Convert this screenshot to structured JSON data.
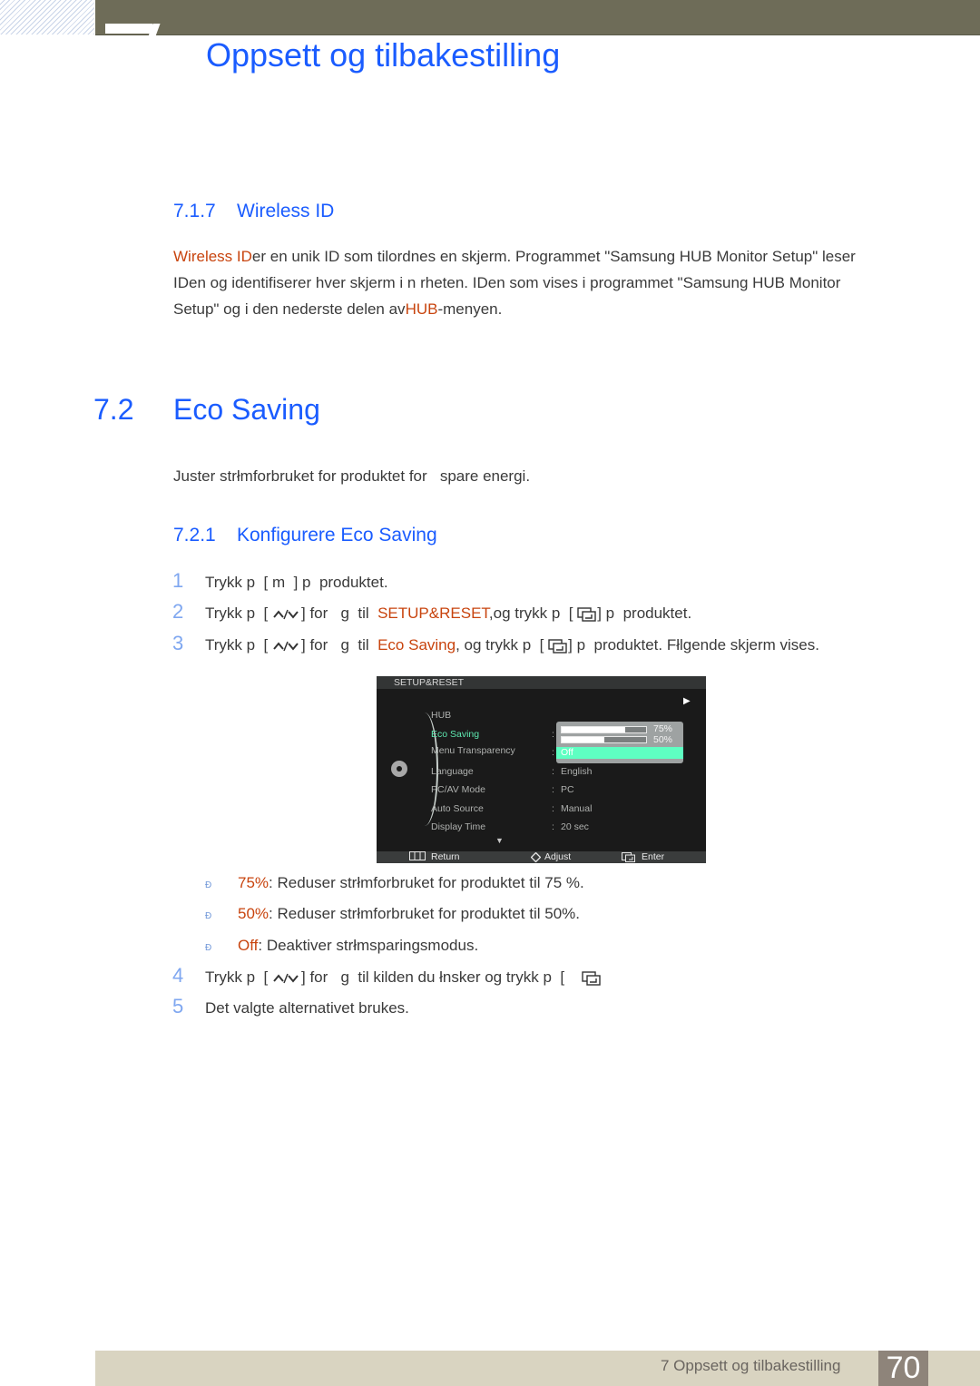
{
  "header": {
    "chapter_title": "Oppsett og tilbakestilling"
  },
  "section_717": {
    "number": "7.1.7",
    "title": "Wireless ID",
    "para": {
      "hl1": "Wireless ID",
      "text1": "er en unik ID som tilordnes en skjerm. Programmet \"Samsung HUB Monitor Setup\" leser",
      "line2": "IDen og identifiserer hver skjerm i n rheten. IDen som vises i programmet \"Samsung HUB Monitor",
      "line3a": "Setup\" og i den nederste delen av",
      "hl2": "HUB",
      "line3b": "-menyen."
    }
  },
  "section_72": {
    "number": "7.2",
    "title": "Eco Saving",
    "intro": "Juster strłmforbruket for produktet for   spare energi."
  },
  "section_721": {
    "number": "7.2.1",
    "title": "Konfigurere Eco Saving",
    "steps": [
      {
        "n": "1",
        "a": "Trykk p  [ m  ] p  produktet."
      },
      {
        "n": "2",
        "a": "Trykk p  [",
        "b": "] for   g  til  ",
        "hl": "SETUP&RESET",
        "c": ",og trykk p  [",
        "d": "] p  produktet."
      },
      {
        "n": "3",
        "a": "Trykk p  [",
        "b": "] for   g  til  ",
        "hl": "Eco Saving",
        "c": ", og trykk p  [",
        "d": "] p  produktet. Fłlgende skjerm vises."
      },
      {
        "n": "4",
        "a": "Trykk p  [",
        "b": "] for   g  til kilden du łnsker og trykk p  ["
      },
      {
        "n": "5",
        "a": "Det valgte alternativet brukes."
      }
    ],
    "bullets": [
      {
        "marker": "Ð",
        "hl": "75%",
        "text": ": Reduser strłmforbruket for produktet til 75 %."
      },
      {
        "marker": "Ð",
        "hl": "50%",
        "text": ": Reduser strłmforbruket for produktet til 50%."
      },
      {
        "marker": "Ð",
        "hl": "Off",
        "text": ": Deaktiver strłmsparingsmodus."
      }
    ]
  },
  "osd": {
    "title": "SETUP&RESET",
    "items": [
      {
        "label": "HUB",
        "value": ""
      },
      {
        "label": "Eco Saving",
        "value": "",
        "selected": true
      },
      {
        "label": "Menu Transparency",
        "value": ""
      },
      {
        "label": "Language",
        "value": "English"
      },
      {
        "label": "PC/AV Mode",
        "value": "PC"
      },
      {
        "label": "Auto Source",
        "value": "Manual"
      },
      {
        "label": "Display Time",
        "value": "20 sec"
      }
    ],
    "options": [
      {
        "label": "75%",
        "level": 0.75
      },
      {
        "label": "50%",
        "level": 0.5
      },
      {
        "label": "Off",
        "highlighted": true
      }
    ],
    "footer": {
      "return": "Return",
      "adjust": "Adjust",
      "enter": "Enter"
    },
    "colors": {
      "selected_text": "#5ee8b0",
      "highlight": "#5effc2"
    }
  },
  "footer": {
    "chapter": "7 Oppsett og tilbakestilling",
    "page": "70"
  },
  "colors": {
    "heading": "#1a5cff",
    "highlight_text": "#c8440e",
    "topbar": "#6e6c58",
    "footer_bar": "#d9d4c1",
    "page_box": "#8e847a"
  }
}
